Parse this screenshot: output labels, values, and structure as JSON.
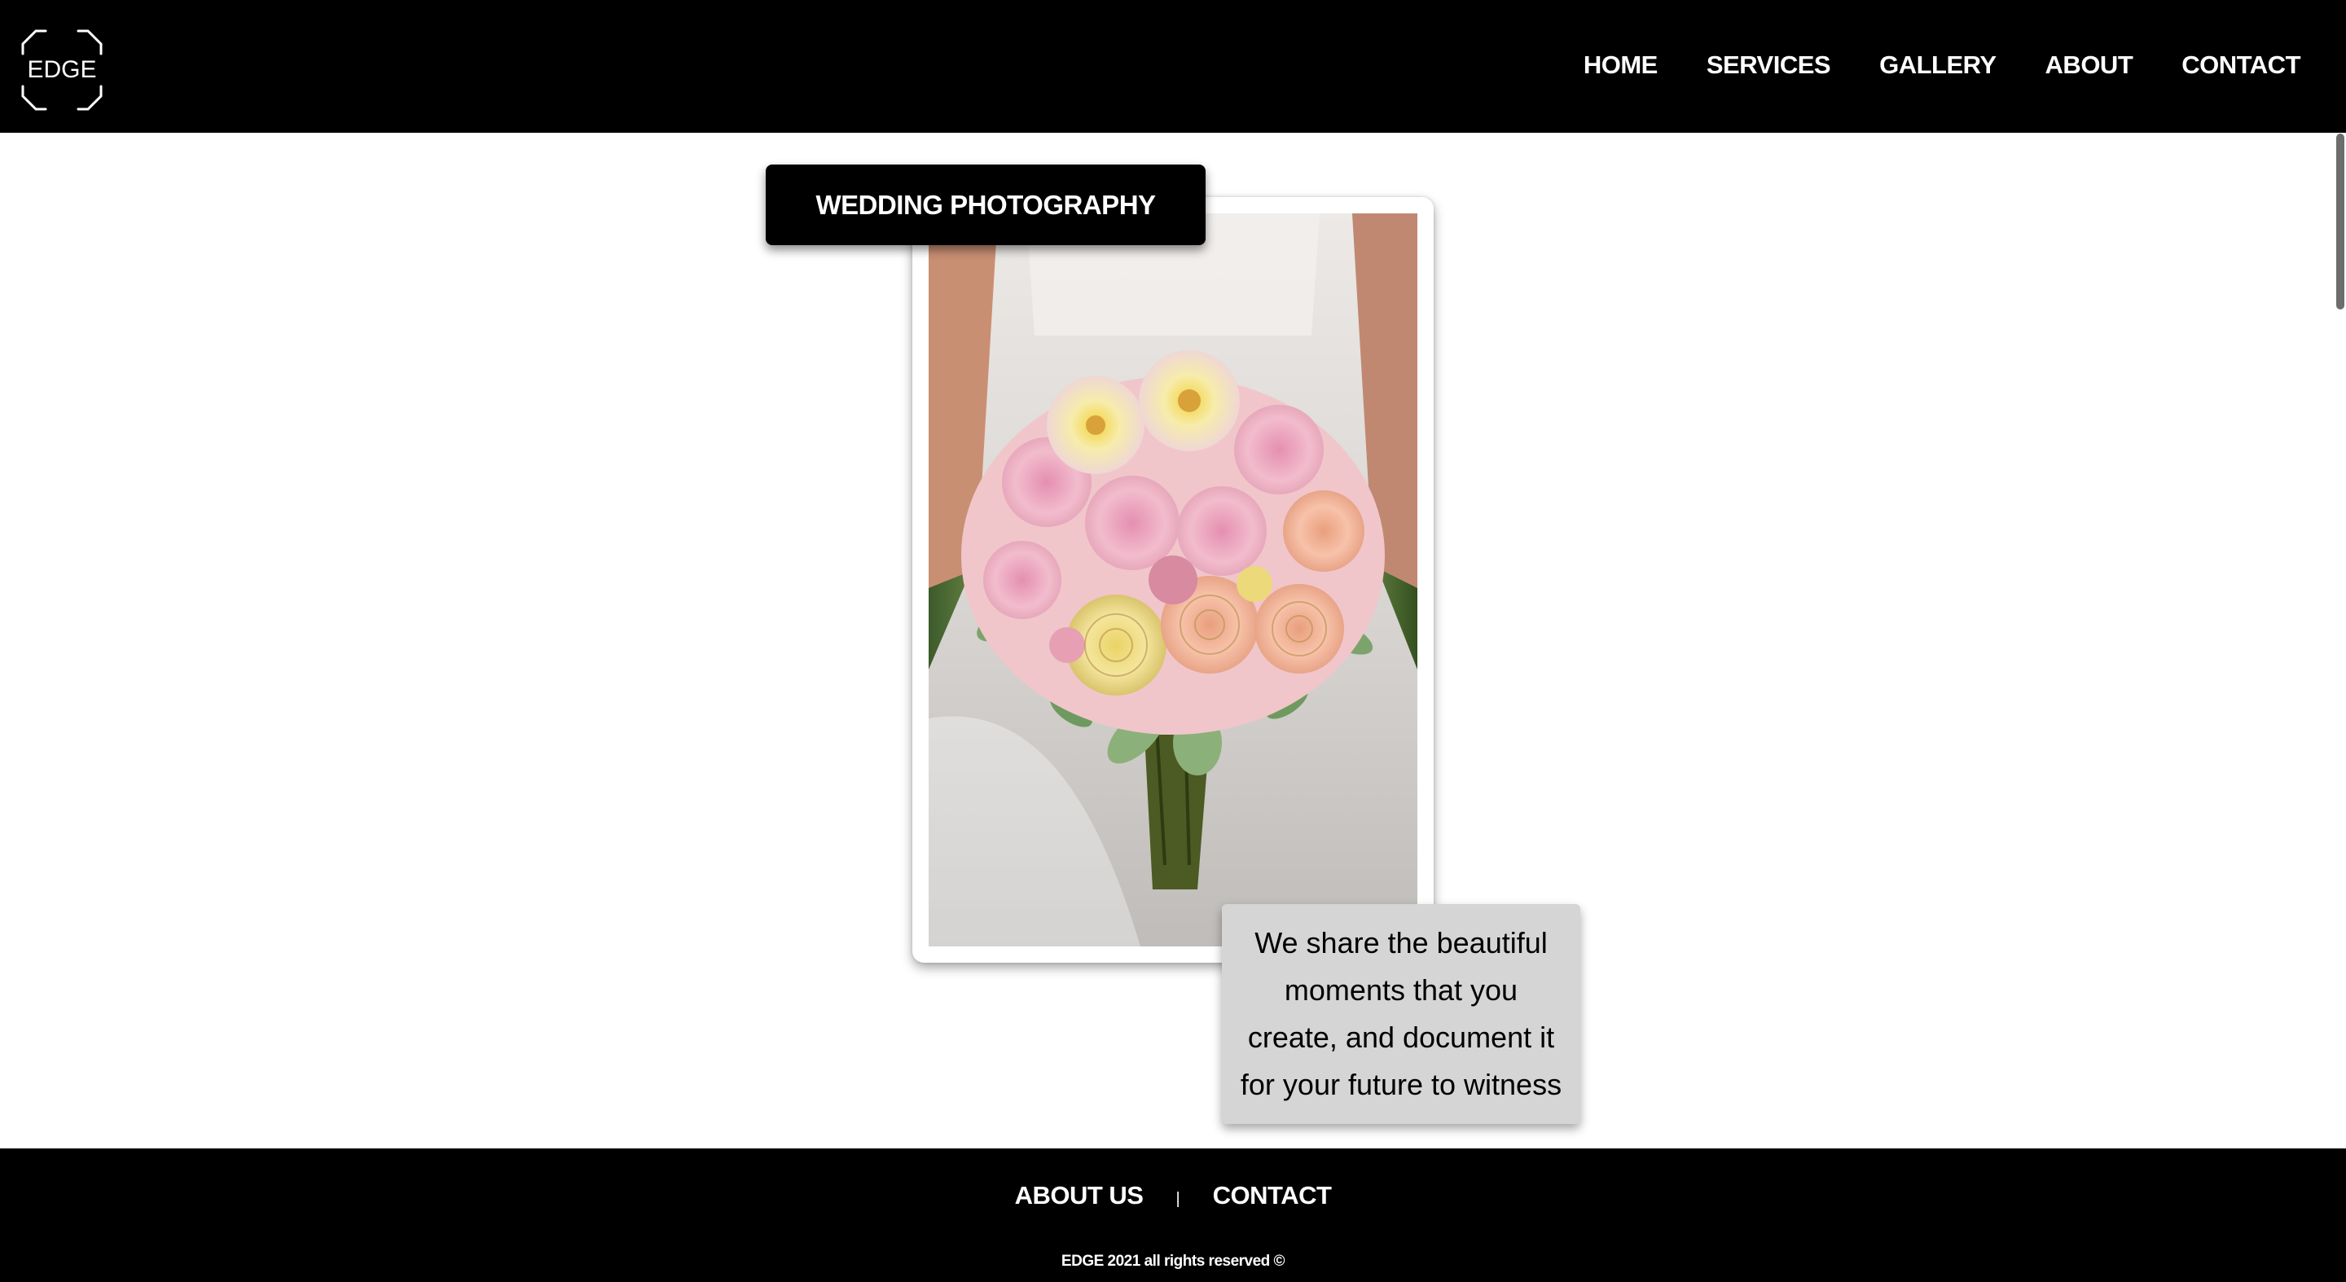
{
  "header": {
    "logo_text": "EDGE",
    "nav": [
      {
        "label": "HOME"
      },
      {
        "label": "SERVICES"
      },
      {
        "label": "GALLERY"
      },
      {
        "label": "ABOUT"
      },
      {
        "label": "CONTACT"
      }
    ]
  },
  "hero": {
    "title": "WEDDING PHOTOGRAPHY",
    "photo_icon": "bridal-bouquet-photo",
    "caption_lines": [
      "We share the beautiful",
      "moments that you",
      "create, and document it",
      "for your future to witness"
    ]
  },
  "footer": {
    "links": [
      {
        "label": "ABOUT US"
      },
      {
        "label": "CONTACT"
      }
    ],
    "separator": "|",
    "copyright": "EDGE 2021 all rights reserved ©"
  },
  "colors": {
    "header_bg": "#000000",
    "footer_bg": "#000000",
    "page_bg": "#ffffff",
    "caption_bg": "#d5d5d5",
    "text_light": "#ffffff"
  }
}
